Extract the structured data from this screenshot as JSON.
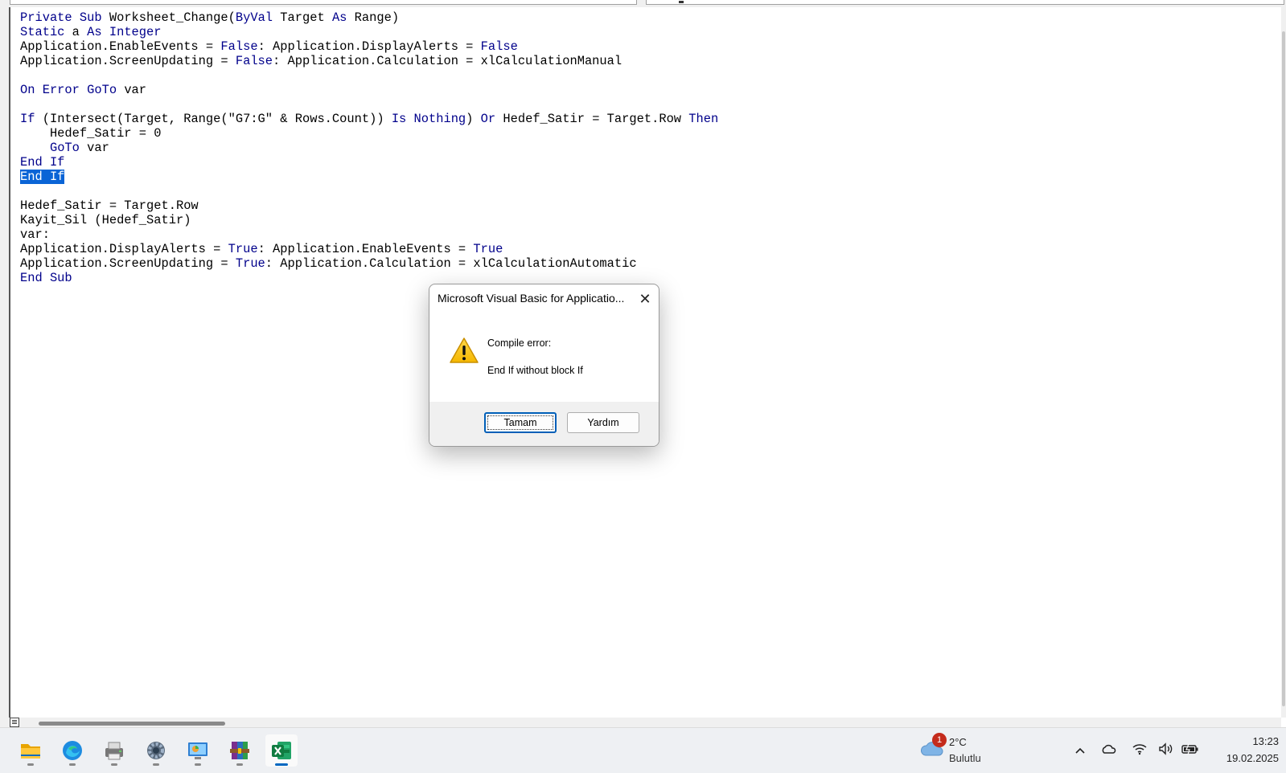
{
  "code_lines": [
    [
      {
        "t": "Private Sub",
        "k": 1
      },
      {
        "t": " Worksheet_Change("
      },
      {
        "t": "ByVal",
        "k": 1
      },
      {
        "t": " Target "
      },
      {
        "t": "As",
        "k": 1
      },
      {
        "t": " Range)"
      }
    ],
    [
      {
        "t": "Static",
        "k": 1
      },
      {
        "t": " a "
      },
      {
        "t": "As Integer",
        "k": 1
      }
    ],
    [
      {
        "t": "Application.EnableEvents = "
      },
      {
        "t": "False",
        "k": 1
      },
      {
        "t": ": Application.DisplayAlerts = "
      },
      {
        "t": "False",
        "k": 1
      }
    ],
    [
      {
        "t": "Application.ScreenUpdating = "
      },
      {
        "t": "False",
        "k": 1
      },
      {
        "t": ": Application.Calculation = xlCalculationManual"
      }
    ],
    [],
    [
      {
        "t": "On Error GoTo",
        "k": 1
      },
      {
        "t": " var"
      }
    ],
    [],
    [
      {
        "t": "If",
        "k": 1
      },
      {
        "t": " (Intersect(Target, Range(\"G7:G\" & Rows.Count)) "
      },
      {
        "t": "Is Nothing",
        "k": 1
      },
      {
        "t": ") "
      },
      {
        "t": "Or",
        "k": 1
      },
      {
        "t": " Hedef_Satir = Target.Row "
      },
      {
        "t": "Then",
        "k": 1
      }
    ],
    [
      {
        "t": "    Hedef_Satir = 0"
      }
    ],
    [
      {
        "t": "    "
      },
      {
        "t": "GoTo",
        "k": 1
      },
      {
        "t": " var"
      }
    ],
    [
      {
        "t": "End If",
        "k": 1
      }
    ],
    [
      {
        "t": "End If",
        "s": 1
      }
    ],
    [],
    [
      {
        "t": "Hedef_Satir = Target.Row"
      }
    ],
    [
      {
        "t": "Kayit_Sil (Hedef_Satir)"
      }
    ],
    [
      {
        "t": "var:"
      }
    ],
    [
      {
        "t": "Application.DisplayAlerts = "
      },
      {
        "t": "True",
        "k": 1
      },
      {
        "t": ": Application.EnableEvents = "
      },
      {
        "t": "True",
        "k": 1
      }
    ],
    [
      {
        "t": "Application.ScreenUpdating = "
      },
      {
        "t": "True",
        "k": 1
      },
      {
        "t": ": Application.Calculation = xlCalculationAutomatic"
      }
    ],
    [
      {
        "t": "End Sub",
        "k": 1
      }
    ]
  ],
  "dialog": {
    "title": "Microsoft Visual Basic for Applicatio...",
    "close_glyph": "✕",
    "message_title": "Compile error:",
    "message_body": "End If without block If",
    "ok_label": "Tamam",
    "help_label": "Yardım"
  },
  "taskbar": {
    "apps": [
      "file-explorer-icon",
      "edge-icon",
      "printer-app-icon",
      "settings-icon",
      "control-panel-icon",
      "winrar-icon",
      "excel-icon"
    ],
    "active_app": "excel-icon",
    "weather": {
      "badge": "1",
      "temp": "2°C",
      "condition": "Bulutlu"
    },
    "clock": {
      "time": "13:23",
      "date": "19.02.2025"
    }
  },
  "colors": {
    "keyword": "#00008b",
    "selection": "#0a64d6",
    "accent": "#0067c0",
    "excel_green": "#107c41"
  }
}
